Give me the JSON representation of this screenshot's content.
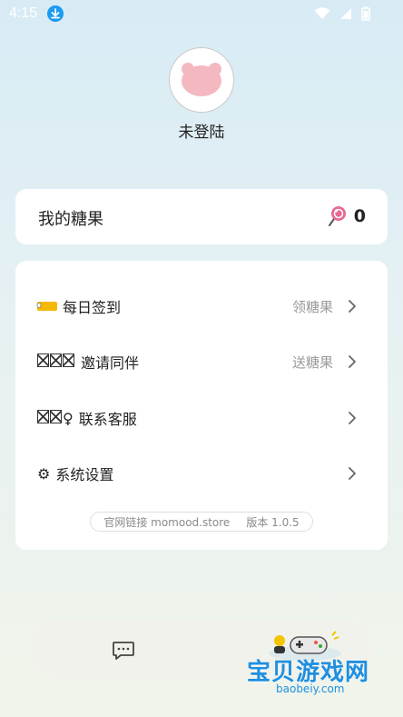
{
  "status_bar": {
    "time": "4:15"
  },
  "profile": {
    "name": "未登陆"
  },
  "candy": {
    "title": "我的糖果",
    "count": "0"
  },
  "menu": {
    "checkin_label": "每日签到",
    "checkin_hint": "领糖果",
    "invite_prefix": "",
    "invite_label": "邀请同伴",
    "invite_hint": "送糖果",
    "support_label": "联系客服",
    "settings_label": "系统设置"
  },
  "footer": {
    "site": "官网链接 momood.store",
    "version": "版本 1.0.5"
  },
  "watermark": {
    "text": "宝贝游戏网",
    "url": "baobeiy.com"
  },
  "colors": {
    "accent": "#1a9bf0",
    "ticket": "#f5b800",
    "candy_pink": "#e86a93"
  }
}
